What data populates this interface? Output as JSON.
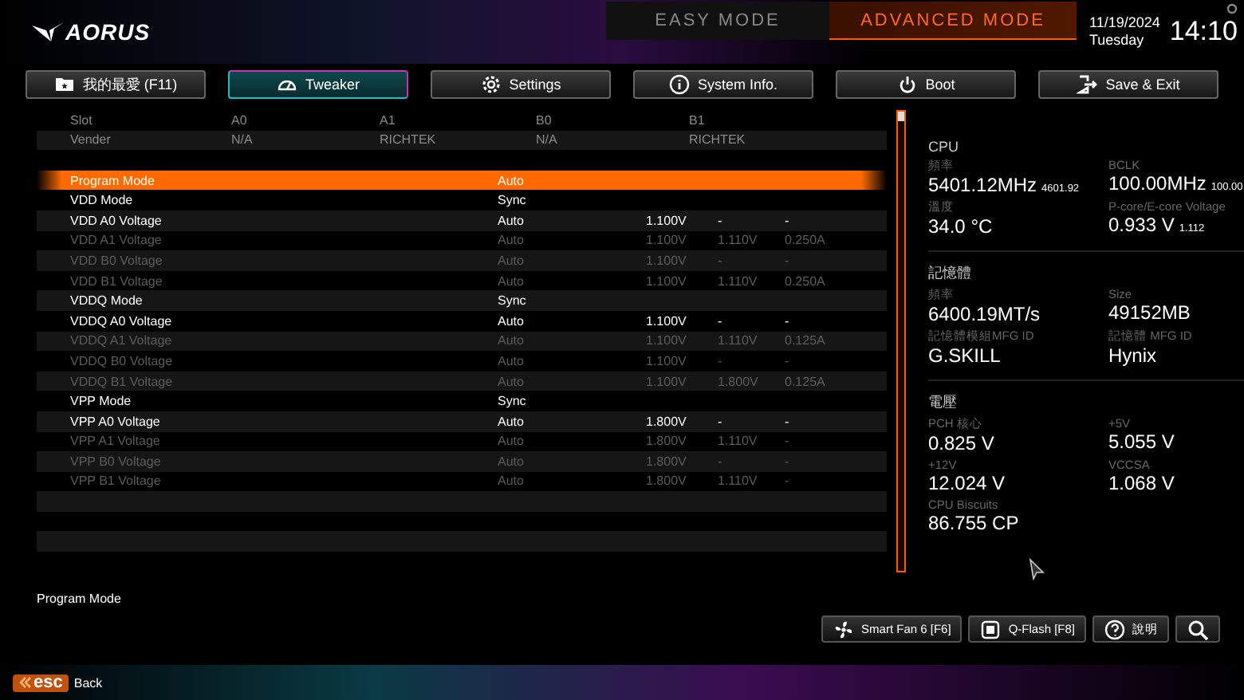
{
  "header": {
    "brand": "AORUS",
    "modes": [
      {
        "label": "EASY MODE",
        "selected": false
      },
      {
        "label": "ADVANCED MODE",
        "selected": true
      }
    ],
    "date": "11/19/2024",
    "weekday": "Tuesday",
    "time": "14:10"
  },
  "tabs": [
    {
      "label": "我的最愛 (F11)",
      "kind": "favorites",
      "selected": false
    },
    {
      "label": "Tweaker",
      "kind": "tweaker",
      "selected": true
    },
    {
      "label": "Settings",
      "kind": "settings",
      "selected": false
    },
    {
      "label": "System Info.",
      "kind": "info",
      "selected": false
    },
    {
      "label": "Boot",
      "kind": "boot",
      "selected": false
    },
    {
      "label": "Save & Exit",
      "kind": "exit",
      "selected": false
    }
  ],
  "slot_table": {
    "rows": [
      [
        "Slot",
        "A0",
        "A1",
        "B0",
        "B1"
      ],
      [
        "Vender",
        "N/A",
        "RICHTEK",
        "N/A",
        "RICHTEK"
      ]
    ]
  },
  "settings": [
    {
      "name": "Program Mode",
      "value": "Auto",
      "disabled": false,
      "selected": true
    },
    {
      "name": "VDD Mode",
      "value": "Sync",
      "disabled": false,
      "selected": false
    },
    {
      "name": "VDD A0 Voltage",
      "value": "Auto",
      "readings": [
        "1.100V",
        "-",
        "-"
      ],
      "disabled": false,
      "selected": false
    },
    {
      "name": "VDD A1 Voltage",
      "value": "Auto",
      "readings": [
        "1.100V",
        "1.110V",
        "0.250A"
      ],
      "disabled": true,
      "selected": false
    },
    {
      "name": "VDD B0 Voltage",
      "value": "Auto",
      "readings": [
        "1.100V",
        "-",
        "-"
      ],
      "disabled": true,
      "selected": false
    },
    {
      "name": "VDD B1 Voltage",
      "value": "Auto",
      "readings": [
        "1.100V",
        "1.110V",
        "0.250A"
      ],
      "disabled": true,
      "selected": false
    },
    {
      "name": "VDDQ Mode",
      "value": "Sync",
      "disabled": false,
      "selected": false
    },
    {
      "name": "VDDQ A0 Voltage",
      "value": "Auto",
      "readings": [
        "1.100V",
        "-",
        "-"
      ],
      "disabled": false,
      "selected": false
    },
    {
      "name": "VDDQ A1 Voltage",
      "value": "Auto",
      "readings": [
        "1.100V",
        "1.110V",
        "0.125A"
      ],
      "disabled": true,
      "selected": false
    },
    {
      "name": "VDDQ B0 Voltage",
      "value": "Auto",
      "readings": [
        "1.100V",
        "-",
        "-"
      ],
      "disabled": true,
      "selected": false
    },
    {
      "name": "VDDQ B1 Voltage",
      "value": "Auto",
      "readings": [
        "1.100V",
        "1.800V",
        "0.125A"
      ],
      "disabled": true,
      "selected": false
    },
    {
      "name": "VPP Mode",
      "value": "Sync",
      "disabled": false,
      "selected": false
    },
    {
      "name": "VPP A0 Voltage",
      "value": "Auto",
      "readings": [
        "1.800V",
        "-",
        "-"
      ],
      "disabled": false,
      "selected": false
    },
    {
      "name": "VPP A1 Voltage",
      "value": "Auto",
      "readings": [
        "1.800V",
        "1.110V",
        "-"
      ],
      "disabled": true,
      "selected": false
    },
    {
      "name": "VPP B0 Voltage",
      "value": "Auto",
      "readings": [
        "1.800V",
        "-",
        "-"
      ],
      "disabled": true,
      "selected": false
    },
    {
      "name": "VPP B1 Voltage",
      "value": "Auto",
      "readings": [
        "1.800V",
        "1.110V",
        "-"
      ],
      "disabled": true,
      "selected": false
    }
  ],
  "monitor": [
    {
      "title": "CPU",
      "items": [
        {
          "label": "頻率",
          "value": "5401.12MHz",
          "sub": "4601.92"
        },
        {
          "label": "BCLK",
          "value": "100.00MHz",
          "sub": "100.00"
        },
        {
          "label": "溫度",
          "value": "34.0 °C"
        },
        {
          "label": "P-core/E-core Voltage",
          "value": "0.933 V",
          "sub": "1.112"
        }
      ]
    },
    {
      "title": "記憶體",
      "items": [
        {
          "label": "頻率",
          "value": "6400.19MT/s"
        },
        {
          "label": "Size",
          "value": "49152MB"
        },
        {
          "label": "記憶體模組MFG ID",
          "value": "G.SKILL"
        },
        {
          "label": "記憶體 MFG ID",
          "value": "Hynix"
        }
      ]
    },
    {
      "title": "電壓",
      "items": [
        {
          "label": "PCH 核心",
          "value": "0.825 V"
        },
        {
          "label": "+5V",
          "value": "5.055 V"
        },
        {
          "label": "+12V",
          "value": "12.024 V"
        },
        {
          "label": "VCCSA",
          "value": "1.068 V"
        },
        {
          "label": "CPU Biscuits",
          "value": "86.755 CP"
        }
      ]
    }
  ],
  "description": "Program Mode",
  "tools": [
    {
      "label": "Smart Fan 6 [F6]",
      "kind": "fan"
    },
    {
      "label": "Q-Flash [F8]",
      "kind": "flash"
    },
    {
      "label": "說明",
      "kind": "help"
    },
    {
      "kind": "search"
    }
  ],
  "footer": {
    "key": "esc",
    "label": "Back"
  }
}
